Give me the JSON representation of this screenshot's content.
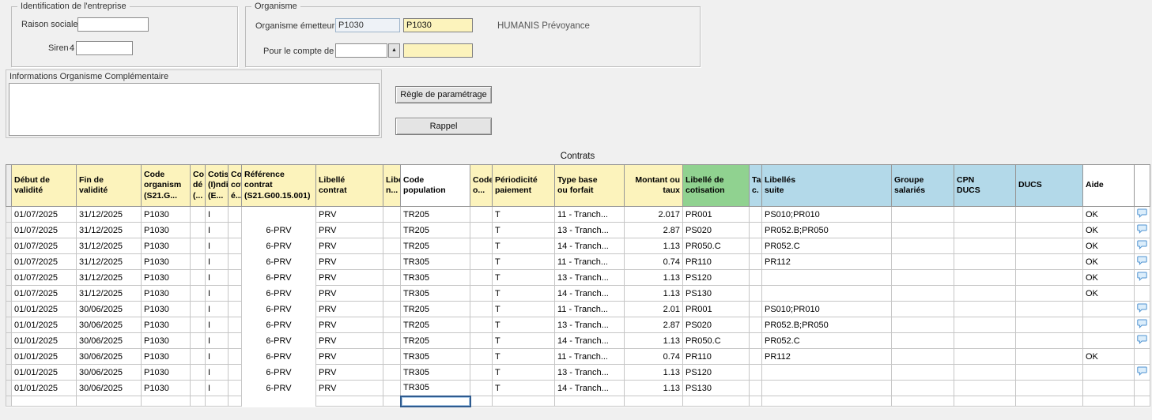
{
  "colors": {
    "yellow": "#fcf3bc",
    "green": "#90d290",
    "blue": "#b3d9e9",
    "white": "#ffffff",
    "gray": "#ececec"
  },
  "icons": {
    "dropdown_glyph": "▲",
    "note_icon": "comment-bubble-icon"
  },
  "identification": {
    "title": "Identification de l'entreprise",
    "raison_sociale": {
      "label": "Raison sociale :",
      "value": ""
    },
    "siren": {
      "label": "Siren :",
      "value": "4",
      "input_value": ""
    }
  },
  "organisme": {
    "title": "Organisme",
    "emetteur": {
      "label": "Organisme émetteur :",
      "code": "P1030",
      "code_confirm": "P1030",
      "name": "HUMANIS Prévoyance"
    },
    "pour_le_compte": {
      "label": "Pour le compte de :",
      "value": "",
      "value_confirm": ""
    }
  },
  "infos_organisme": {
    "title": "Informations Organisme Complémentaire",
    "value": ""
  },
  "actions": {
    "regle_parametrage": "Règle de paramétrage",
    "rappel": "Rappel"
  },
  "contrats": {
    "title": "Contrats",
    "columns": [
      {
        "key": "sel",
        "label": "",
        "bg": "gray"
      },
      {
        "key": "debut",
        "label": "Début de\nvalidité",
        "bg": "yellow"
      },
      {
        "key": "fin",
        "label": "Fin de\nvalidité",
        "bg": "yellow"
      },
      {
        "key": "code_org",
        "label": "Code\norganism\n(S21.G...",
        "bg": "yellow"
      },
      {
        "key": "co",
        "label": "Co\ndé\n(...",
        "bg": "yellow"
      },
      {
        "key": "cotis",
        "label": "Cotis\n(I)ndi\n(E...",
        "bg": "yellow"
      },
      {
        "key": "coc",
        "label": "Coc\ncot\né...",
        "bg": "yellow"
      },
      {
        "key": "reference",
        "label": "Référence\ncontrat\n(S21.G00.15.001)",
        "bg": "yellow"
      },
      {
        "key": "lib_contrat",
        "label": "Libellé\ncontrat",
        "bg": "yellow"
      },
      {
        "key": "libe",
        "label": "Libe\nn...",
        "bg": "yellow"
      },
      {
        "key": "code_pop",
        "label": "Code\npopulation",
        "bg": "white"
      },
      {
        "key": "code_o",
        "label": "Code\no...",
        "bg": "yellow"
      },
      {
        "key": "periodicite",
        "label": "Périodicité\npaiement",
        "bg": "yellow"
      },
      {
        "key": "type_base",
        "label": "Type base\nou forfait",
        "bg": "yellow"
      },
      {
        "key": "montant",
        "label": "Montant ou\ntaux",
        "bg": "yellow"
      },
      {
        "key": "lib_cotisation",
        "label": "Libellé de\ncotisation",
        "bg": "green"
      },
      {
        "key": "ta",
        "label": "Ta\nc.",
        "bg": "blue"
      },
      {
        "key": "lib_suite",
        "label": "Libellés\nsuite",
        "bg": "blue"
      },
      {
        "key": "groupe",
        "label": "Groupe\nsalariés",
        "bg": "blue"
      },
      {
        "key": "cpn",
        "label": "CPN\nDUCS",
        "bg": "blue"
      },
      {
        "key": "ducs",
        "label": "DUCS",
        "bg": "blue"
      },
      {
        "key": "aide",
        "label": "Aide",
        "bg": "white"
      },
      {
        "key": "note",
        "label": "",
        "bg": "white"
      }
    ],
    "rows": [
      {
        "debut": "01/07/2025",
        "fin": "31/12/2025",
        "code_org": "P1030",
        "co": "",
        "cotis": "I",
        "coc": "",
        "reference": "",
        "lib_contrat": "PRV",
        "libe": "",
        "code_pop": "TR205",
        "code_o": "",
        "periodicite": "T",
        "type_base": "11 - Tranch...",
        "montant": "2.017",
        "lib_cotisation": "PR001",
        "ta": "",
        "lib_suite": "PS010;PR010",
        "groupe": "",
        "cpn": "",
        "ducs": "",
        "aide": "OK",
        "note": true
      },
      {
        "debut": "01/07/2025",
        "fin": "31/12/2025",
        "code_org": "P1030",
        "co": "",
        "cotis": "I",
        "coc": "",
        "reference": "6-PRV",
        "lib_contrat": "PRV",
        "libe": "",
        "code_pop": "TR205",
        "code_o": "",
        "periodicite": "T",
        "type_base": "13 - Tranch...",
        "montant": "2.87",
        "lib_cotisation": "PS020",
        "ta": "",
        "lib_suite": "PR052.B;PR050",
        "groupe": "",
        "cpn": "",
        "ducs": "",
        "aide": "OK",
        "note": true
      },
      {
        "debut": "01/07/2025",
        "fin": "31/12/2025",
        "code_org": "P1030",
        "co": "",
        "cotis": "I",
        "coc": "",
        "reference": "6-PRV",
        "lib_contrat": "PRV",
        "libe": "",
        "code_pop": "TR205",
        "code_o": "",
        "periodicite": "T",
        "type_base": "14 - Tranch...",
        "montant": "1.13",
        "lib_cotisation": "PR050.C",
        "ta": "",
        "lib_suite": "PR052.C",
        "groupe": "",
        "cpn": "",
        "ducs": "",
        "aide": "OK",
        "note": true
      },
      {
        "debut": "01/07/2025",
        "fin": "31/12/2025",
        "code_org": "P1030",
        "co": "",
        "cotis": "I",
        "coc": "",
        "reference": "6-PRV",
        "lib_contrat": "PRV",
        "libe": "",
        "code_pop": "TR305",
        "code_o": "",
        "periodicite": "T",
        "type_base": "11 - Tranch...",
        "montant": "0.74",
        "lib_cotisation": "PR110",
        "ta": "",
        "lib_suite": "PR112",
        "groupe": "",
        "cpn": "",
        "ducs": "",
        "aide": "OK",
        "note": true
      },
      {
        "debut": "01/07/2025",
        "fin": "31/12/2025",
        "code_org": "P1030",
        "co": "",
        "cotis": "I",
        "coc": "",
        "reference": "6-PRV",
        "lib_contrat": "PRV",
        "libe": "",
        "code_pop": "TR305",
        "code_o": "",
        "periodicite": "T",
        "type_base": "13 - Tranch...",
        "montant": "1.13",
        "lib_cotisation": "PS120",
        "ta": "",
        "lib_suite": "",
        "groupe": "",
        "cpn": "",
        "ducs": "",
        "aide": "OK",
        "note": true
      },
      {
        "debut": "01/07/2025",
        "fin": "31/12/2025",
        "code_org": "P1030",
        "co": "",
        "cotis": "I",
        "coc": "",
        "reference": "6-PRV",
        "lib_contrat": "PRV",
        "libe": "",
        "code_pop": "TR305",
        "code_o": "",
        "periodicite": "T",
        "type_base": "14 - Tranch...",
        "montant": "1.13",
        "lib_cotisation": "PS130",
        "ta": "",
        "lib_suite": "",
        "groupe": "",
        "cpn": "",
        "ducs": "",
        "aide": "OK",
        "note": false
      },
      {
        "debut": "01/01/2025",
        "fin": "30/06/2025",
        "code_org": "P1030",
        "co": "",
        "cotis": "I",
        "coc": "",
        "reference": "6-PRV",
        "lib_contrat": "PRV",
        "libe": "",
        "code_pop": "TR205",
        "code_o": "",
        "periodicite": "T",
        "type_base": "11 - Tranch...",
        "montant": "2.01",
        "lib_cotisation": "PR001",
        "ta": "",
        "lib_suite": "PS010;PR010",
        "groupe": "",
        "cpn": "",
        "ducs": "",
        "aide": "",
        "note": true
      },
      {
        "debut": "01/01/2025",
        "fin": "30/06/2025",
        "code_org": "P1030",
        "co": "",
        "cotis": "I",
        "coc": "",
        "reference": "6-PRV",
        "lib_contrat": "PRV",
        "libe": "",
        "code_pop": "TR205",
        "code_o": "",
        "periodicite": "T",
        "type_base": "13 - Tranch...",
        "montant": "2.87",
        "lib_cotisation": "PS020",
        "ta": "",
        "lib_suite": "PR052.B;PR050",
        "groupe": "",
        "cpn": "",
        "ducs": "",
        "aide": "",
        "note": true
      },
      {
        "debut": "01/01/2025",
        "fin": "30/06/2025",
        "code_org": "P1030",
        "co": "",
        "cotis": "I",
        "coc": "",
        "reference": "6-PRV",
        "lib_contrat": "PRV",
        "libe": "",
        "code_pop": "TR205",
        "code_o": "",
        "periodicite": "T",
        "type_base": "14 - Tranch...",
        "montant": "1.13",
        "lib_cotisation": "PR050.C",
        "ta": "",
        "lib_suite": "PR052.C",
        "groupe": "",
        "cpn": "",
        "ducs": "",
        "aide": "",
        "note": true
      },
      {
        "debut": "01/01/2025",
        "fin": "30/06/2025",
        "code_org": "P1030",
        "co": "",
        "cotis": "I",
        "coc": "",
        "reference": "6-PRV",
        "lib_contrat": "PRV",
        "libe": "",
        "code_pop": "TR305",
        "code_o": "",
        "periodicite": "T",
        "type_base": "11 - Tranch...",
        "montant": "0.74",
        "lib_cotisation": "PR110",
        "ta": "",
        "lib_suite": "PR112",
        "groupe": "",
        "cpn": "",
        "ducs": "",
        "aide": "OK",
        "note": false
      },
      {
        "debut": "01/01/2025",
        "fin": "30/06/2025",
        "code_org": "P1030",
        "co": "",
        "cotis": "I",
        "coc": "",
        "reference": "6-PRV",
        "lib_contrat": "PRV",
        "libe": "",
        "code_pop": "TR305",
        "code_o": "",
        "periodicite": "T",
        "type_base": "13 - Tranch...",
        "montant": "1.13",
        "lib_cotisation": "PS120",
        "ta": "",
        "lib_suite": "",
        "groupe": "",
        "cpn": "",
        "ducs": "",
        "aide": "",
        "note": true
      },
      {
        "debut": "01/01/2025",
        "fin": "30/06/2025",
        "code_org": "P1030",
        "co": "",
        "cotis": "I",
        "coc": "",
        "reference": "6-PRV",
        "lib_contrat": "PRV",
        "libe": "",
        "code_pop": "TR305",
        "code_o": "",
        "periodicite": "T",
        "type_base": "14 - Tranch...",
        "montant": "1.13",
        "lib_cotisation": "PS130",
        "ta": "",
        "lib_suite": "",
        "groupe": "",
        "cpn": "",
        "ducs": "",
        "aide": "",
        "note": false
      }
    ],
    "partial_row": {
      "focused_key": "code_pop"
    }
  }
}
